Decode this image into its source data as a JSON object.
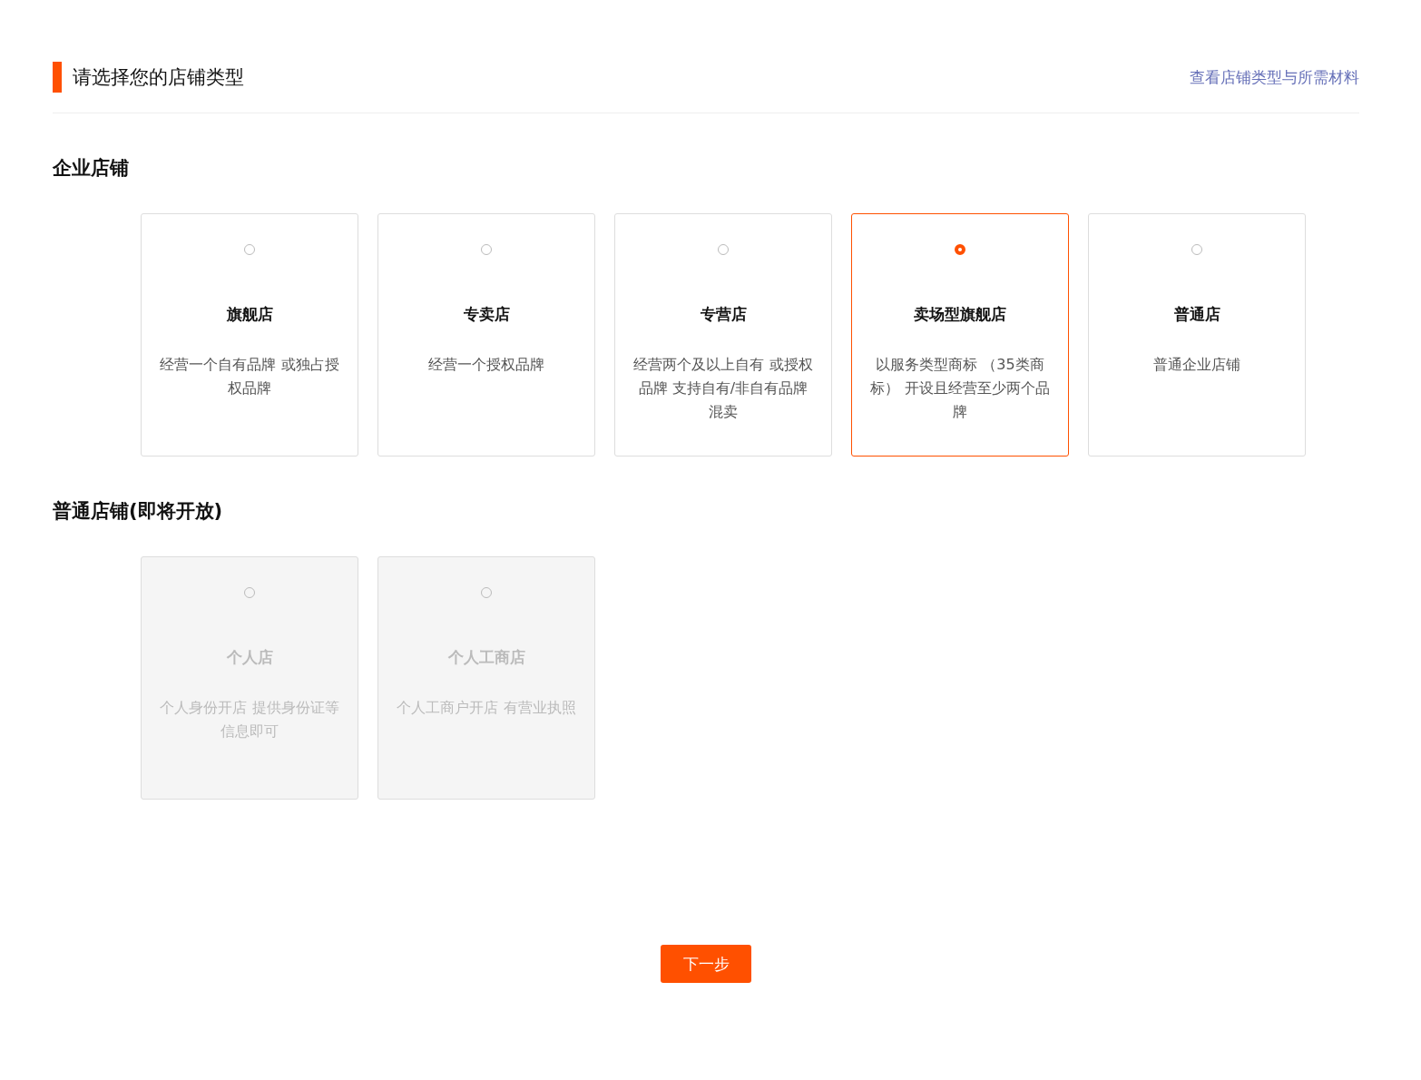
{
  "header": {
    "title": "请选择您的店铺类型",
    "link": "查看店铺类型与所需材料"
  },
  "sections": [
    {
      "title": "企业店铺",
      "cards": [
        {
          "title": "旗舰店",
          "description": "经营一个自有品牌 或独占授权品牌",
          "selected": false,
          "disabled": false
        },
        {
          "title": "专卖店",
          "description": "经营一个授权品牌",
          "selected": false,
          "disabled": false
        },
        {
          "title": "专营店",
          "description": "经营两个及以上自有 或授权品牌 支持自有/非自有品牌混卖",
          "selected": false,
          "disabled": false
        },
        {
          "title": "卖场型旗舰店",
          "description": "以服务类型商标 （35类商标） 开设且经营至少两个品牌",
          "selected": true,
          "disabled": false
        },
        {
          "title": "普通店",
          "description": "普通企业店铺",
          "selected": false,
          "disabled": false
        }
      ]
    },
    {
      "title": "普通店铺(即将开放)",
      "cards": [
        {
          "title": "个人店",
          "description": "个人身份开店 提供身份证等信息即可",
          "selected": false,
          "disabled": true
        },
        {
          "title": "个人工商店",
          "description": "个人工商户开店 有营业执照",
          "selected": false,
          "disabled": true
        }
      ]
    }
  ],
  "next_button": "下一步"
}
